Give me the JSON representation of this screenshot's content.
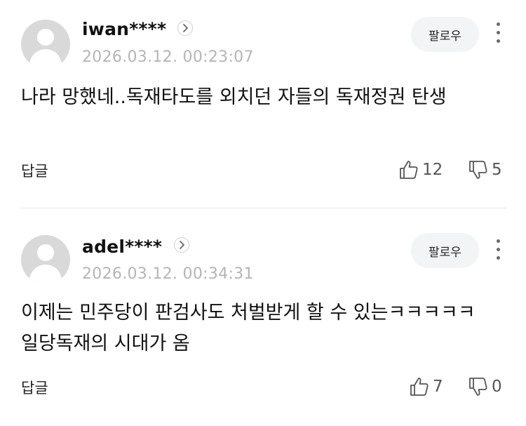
{
  "comments": [
    {
      "username": "iwan****",
      "timestamp": "2026.03.12. 00:23:07",
      "follow_label": "팔로우",
      "text": "나라 망했네..독재타도를 외치던 자들의 독재정권 탄생",
      "reply_label": "답글",
      "likes": "12",
      "dislikes": "5"
    },
    {
      "username": "adel****",
      "timestamp": "2026.03.12. 00:34:31",
      "follow_label": "팔로우",
      "text": "이제는 민주당이 판검사도 처벌받게 할 수 있는ㅋㅋㅋㅋㅋ 일당독재의 시대가 옴",
      "reply_label": "답글",
      "likes": "7",
      "dislikes": "0"
    }
  ],
  "icons": {
    "avatar": "default-user-avatar",
    "profile": "chevron-right-icon",
    "more": "more-vertical-icon",
    "like": "thumbs-up-icon",
    "dislike": "thumbs-down-icon"
  }
}
